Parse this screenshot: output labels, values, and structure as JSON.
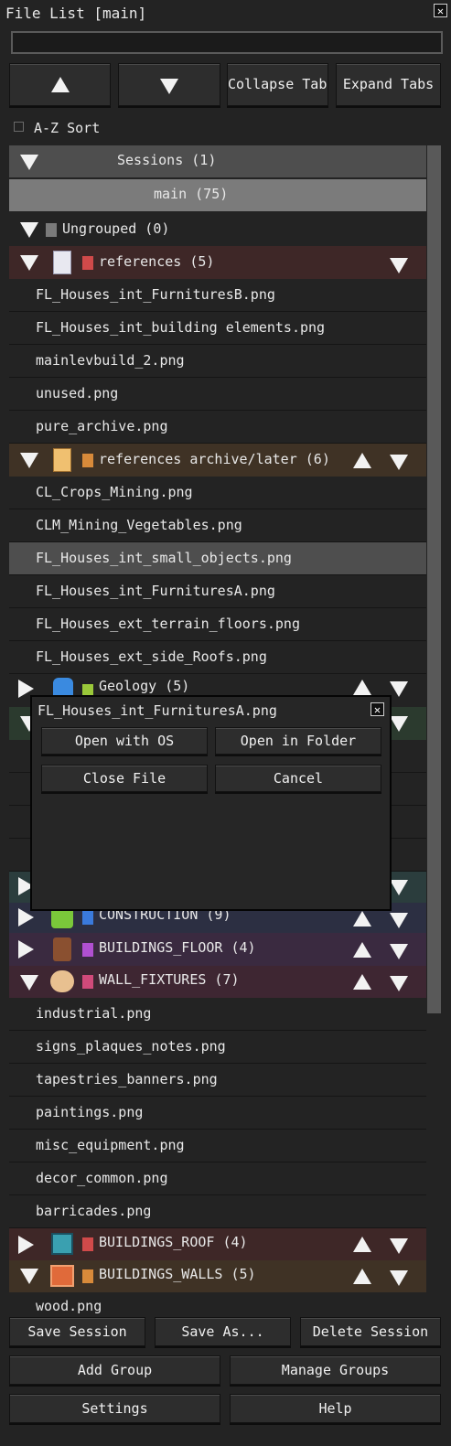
{
  "window": {
    "title": "File List [main]",
    "close": "✕"
  },
  "search": {
    "placeholder": ""
  },
  "toolbar": {
    "up": "▲",
    "down": "▼",
    "collapse": "Collapse Tabs",
    "expand": "Expand Tabs"
  },
  "sort": {
    "label": "A-Z Sort",
    "checked": false
  },
  "sessions": {
    "label": "Sessions (1)",
    "current": "main (75)"
  },
  "groups": {
    "ungrouped": "Ungrouped (0)",
    "references": {
      "label": "references (5)",
      "color": "#d04a4a",
      "files": [
        "FL_Houses_int_FurnituresB.png",
        "FL_Houses_int_building elements.png",
        "mainlevbuild_2.png",
        "unused.png",
        "pure_archive.png"
      ]
    },
    "archive": {
      "label": "references archive/later (6)",
      "color": "#d88a3a",
      "files": [
        "CL_Crops_Mining.png",
        "CLM_Mining_Vegetables.png",
        "FL_Houses_int_small_objects.png",
        "FL_Houses_int_FurnituresA.png",
        "FL_Houses_ext_terrain_floors.png",
        "FL_Houses_ext_side_Roofs.png"
      ]
    },
    "geology": {
      "label": "Geology (5)",
      "color": "#9ac83a"
    },
    "construction": {
      "label": "CONSTRUCTION (9)",
      "color": "#3a7adc"
    },
    "buildings_floor": {
      "label": "BUILDINGS_FLOOR (4)",
      "color": "#b050d0"
    },
    "wall_fixtures": {
      "label": "WALL_FIXTURES (7)",
      "color": "#d04a7a",
      "files": [
        "industrial.png",
        "signs_plaques_notes.png",
        "tapestries_banners.png",
        "paintings.png",
        "misc_equipment.png",
        "decor_common.png",
        "barricades.png"
      ]
    },
    "buildings_roof": {
      "label": "BUILDINGS_ROOF (4)",
      "color": "#d04a4a"
    },
    "buildings_walls": {
      "label": "BUILDINGS_WALLS (5)",
      "color": "#d88a3a",
      "files": [
        "wood.png"
      ]
    }
  },
  "popup": {
    "title": "FL_Houses_int_FurnituresA.png",
    "open_os": "Open with OS",
    "open_folder": "Open in Folder",
    "close_file": "Close File",
    "cancel": "Cancel"
  },
  "footer": {
    "save": "Save Session",
    "save_as": "Save As...",
    "delete": "Delete Session",
    "add_group": "Add Group",
    "manage_groups": "Manage Groups",
    "settings": "Settings",
    "help": "Help"
  }
}
